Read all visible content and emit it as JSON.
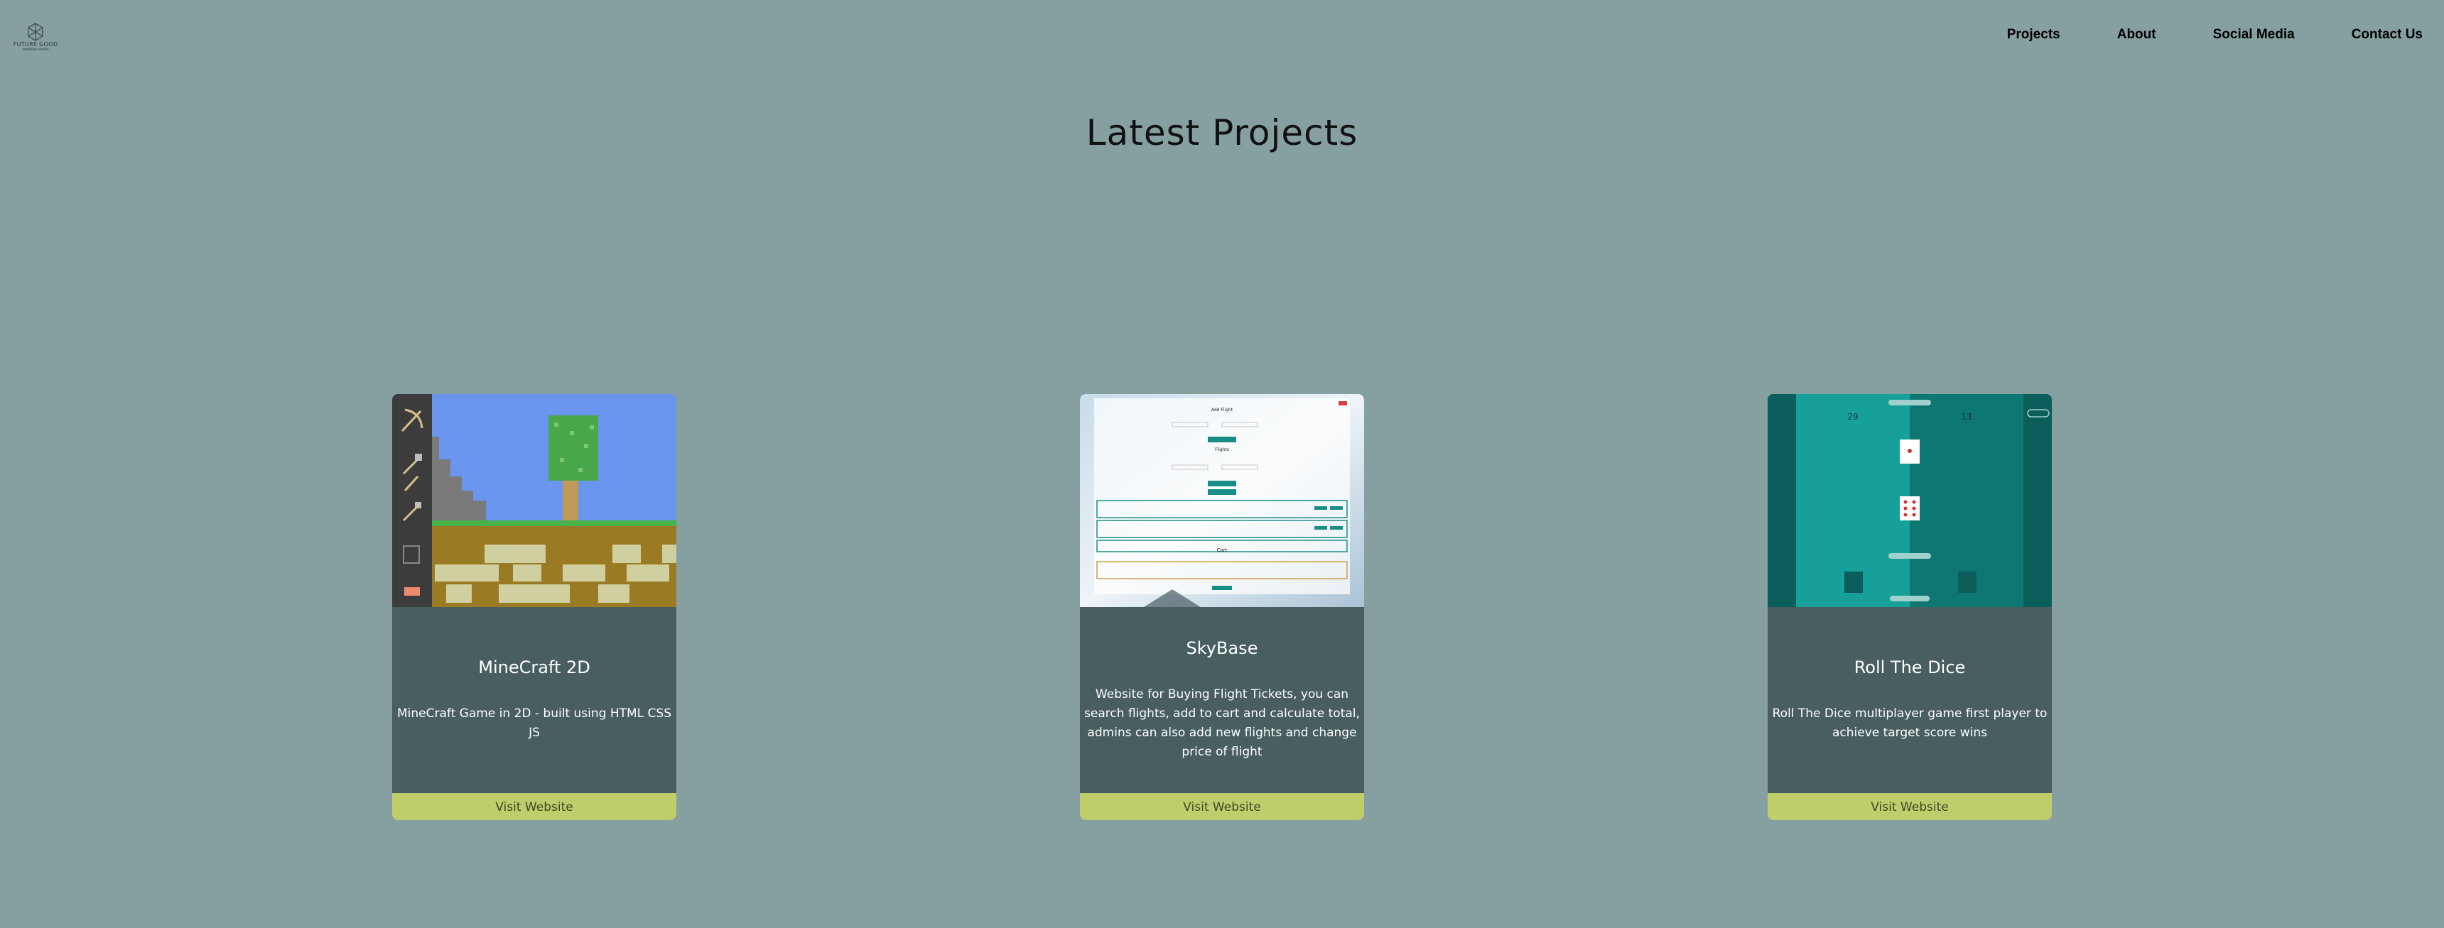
{
  "logo": {
    "name": "FUTURE GOOD",
    "tagline": "creative studio"
  },
  "nav": [
    {
      "label": "Projects"
    },
    {
      "label": "About"
    },
    {
      "label": "Social Media"
    },
    {
      "label": "Contact Us"
    }
  ],
  "heading": "Latest Projects",
  "projects": [
    {
      "title": "MineCraft 2D",
      "description": "MineCraft Game in 2D - built using HTML CSS JS",
      "button": "Visit Website",
      "thumb_colors": {
        "sky": "#6a96ef",
        "grass": "#47b24a",
        "dirt": "#9b7a24",
        "toolbar": "#3c3c3c"
      }
    },
    {
      "title": "SkyBase",
      "description": "Website for Buying Flight Tickets, you can search flights, add to cart and calculate total, admins can also add new flights and change price of flight",
      "button": "Visit Website",
      "thumb_text": {
        "add_flight": "Add Flight",
        "flights": "Flights",
        "cart": "Cart"
      },
      "thumb_colors": {
        "accent": "#1a8e86",
        "cart_border": "#c8a24b"
      }
    },
    {
      "title": "Roll The Dice",
      "description": "Roll The Dice multiplayer game first player to achieve target score wins",
      "button": "Visit Website",
      "thumb_text": {
        "score1": "29",
        "score2": "13"
      },
      "thumb_colors": {
        "left": "#17a09a",
        "right": "#0f7773",
        "edge": "#0c5e5c"
      }
    }
  ],
  "colors": {
    "background": "#869fa1",
    "card": "#485e60",
    "button": "#c0cd6b"
  }
}
